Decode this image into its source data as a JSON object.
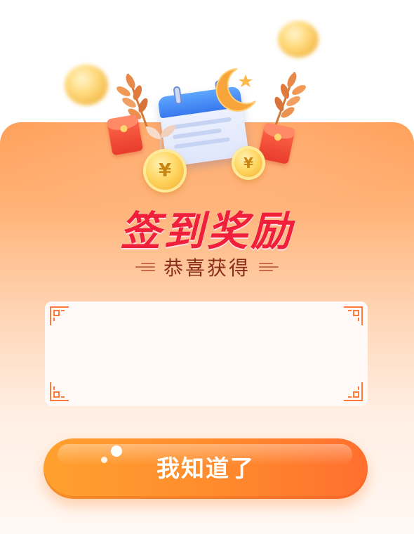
{
  "dialog": {
    "title": "签到奖励",
    "subtitle": "恭喜获得",
    "coin_symbol": "¥",
    "confirm_button_label": "我知道了"
  },
  "colors": {
    "title": "#f01f3a",
    "subtitle": "#8a2e1c",
    "button_start": "#ffa12e",
    "button_end": "#ff6f2f",
    "card_top": "#ff9d55",
    "card_bottom": "#fff8f3",
    "corner_ornament": "#ff7a3d"
  },
  "icons": [
    "calendar-icon",
    "moon-star-icon",
    "red-envelope-icon",
    "gold-coin-icon",
    "wheat-branch-icon",
    "sprout-icon"
  ]
}
